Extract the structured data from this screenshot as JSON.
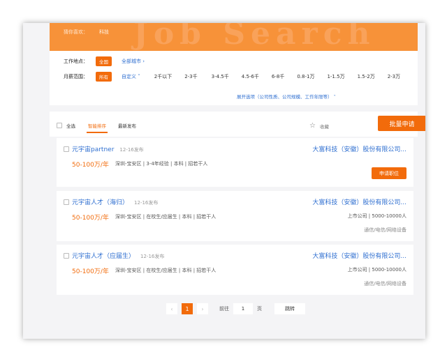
{
  "banner": {
    "watermark": "Job Search",
    "hint_label": "猜你喜欢：",
    "hint_value": "科技"
  },
  "filter": {
    "location_label": "工作地点：",
    "location_selected": "全国",
    "location_link": "全部城市",
    "salary_label": "月薪范围：",
    "salary_selected": "所有",
    "salary_custom": "自定义",
    "salary_options": [
      "2千以下",
      "2-3千",
      "3-4.5千",
      "4.5-6千",
      "6-8千",
      "0.8-1万",
      "1-1.5万",
      "1.5-2万",
      "2-3万"
    ],
    "expand_text": "展开选项（公司性质、公司规模、工作年限等）"
  },
  "toolbar": {
    "select_all": "全选",
    "sort_smart": "智能排序",
    "sort_latest": "最新发布",
    "favorite": "收藏",
    "bulk_apply": "批量申请"
  },
  "jobs": [
    {
      "title": "元宇宙partner",
      "date": "12-16发布",
      "salary": "50-100万/年",
      "info": "深圳-宝安区 | 3-4年经验 | 本科 | 招若干人",
      "company": "大富科技（安徽）股份有限公司...",
      "meta": "",
      "industry": "",
      "apply": "申请职位"
    },
    {
      "title": "元宇宙人才（海归）",
      "date": "12-16发布",
      "salary": "50-100万/年",
      "info": "深圳-宝安区 | 在校生/应届生 | 本科 | 招若干人",
      "company": "大富科技（安徽）股份有限公司...",
      "meta": "上市公司 | 5000-10000人",
      "industry": "通信/电信/网络设备"
    },
    {
      "title": "元宇宙人才（应届生）",
      "date": "12-16发布",
      "salary": "50-100万/年",
      "info": "深圳-宝安区 | 在校生/应届生 | 本科 | 招若干人",
      "company": "大富科技（安徽）股份有限公司...",
      "meta": "上市公司 | 5000-10000人",
      "industry": "通信/电信/网络设备"
    }
  ],
  "pager": {
    "prev": "‹",
    "current": "1",
    "next": "›",
    "goto_label": "前往",
    "goto_value": "1",
    "page_unit": "页",
    "jump": "跳转"
  },
  "colors": {
    "accent": "#f26b0b",
    "link": "#2f6fd0",
    "banner": "#f79239"
  }
}
